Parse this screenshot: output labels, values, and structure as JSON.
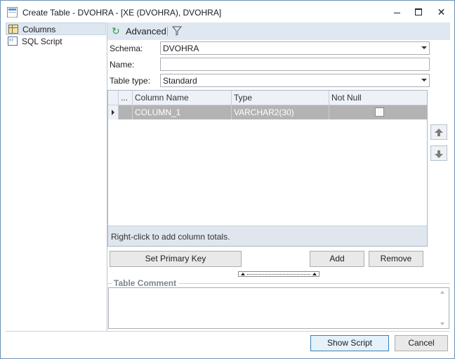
{
  "window": {
    "title": "Create Table - DVOHRA - [XE (DVOHRA), DVOHRA]",
    "minimize_glyph": "",
    "close_glyph": "✕"
  },
  "sidebar": {
    "items": [
      {
        "label": "Columns",
        "icon": "columns-icon",
        "selected": true
      },
      {
        "label": "SQL Script",
        "icon": "sql-script-icon",
        "selected": false
      }
    ]
  },
  "toolbar": {
    "advanced_label": "Advanced",
    "refresh_icon_glyph": "↻"
  },
  "form": {
    "schema_label": "Schema:",
    "schema_value": "DVOHRA",
    "name_label": "Name:",
    "name_value": "",
    "table_type_label": "Table type:",
    "table_type_value": "Standard"
  },
  "grid": {
    "headers": [
      "...",
      "Column Name",
      "Type",
      "Not Null"
    ],
    "rows": [
      {
        "column_name": "COLUMN_1",
        "type": "VARCHAR2(30)",
        "not_null": false
      }
    ],
    "footer": "Right-click to add column totals."
  },
  "buttons": {
    "set_primary_key": "Set Primary Key",
    "add": "Add",
    "remove": "Remove",
    "show_script": "Show Script",
    "cancel": "Cancel"
  },
  "comment": {
    "title": "Table Comment",
    "value": ""
  }
}
